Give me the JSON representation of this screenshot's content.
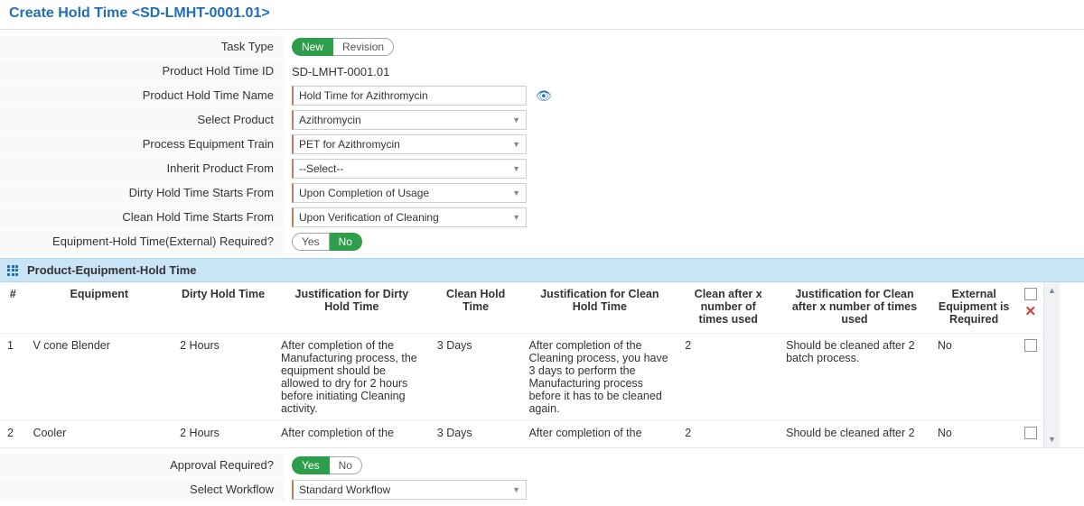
{
  "header": {
    "title": "Create Hold Time <SD-LMHT-0001.01>"
  },
  "form": {
    "task_type": {
      "label": "Task Type",
      "options": {
        "new": "New",
        "revision": "Revision"
      },
      "active": "new"
    },
    "hold_time_id": {
      "label": "Product Hold Time ID",
      "value": "SD-LMHT-0001.01"
    },
    "hold_time_name": {
      "label": "Product Hold Time Name",
      "value": "Hold Time for Azithromycin"
    },
    "select_product": {
      "label": "Select Product",
      "value": "Azithromycin"
    },
    "pet": {
      "label": "Process Equipment Train",
      "value": "PET for Azithromycin"
    },
    "inherit_from": {
      "label": "Inherit Product From",
      "value": "--Select--"
    },
    "dht_starts": {
      "label": "Dirty Hold Time Starts From",
      "value": "Upon Completion of Usage"
    },
    "cht_starts": {
      "label": "Clean Hold Time Starts From",
      "value": "Upon Verification of Cleaning"
    },
    "ext_required": {
      "label": "Equipment-Hold Time(External) Required?",
      "options": {
        "yes": "Yes",
        "no": "No"
      },
      "active": "no"
    },
    "approval_required": {
      "label": "Approval Required?",
      "options": {
        "yes": "Yes",
        "no": "No"
      },
      "active": "yes"
    },
    "select_workflow": {
      "label": "Select Workflow",
      "value": "Standard Workflow"
    }
  },
  "section": {
    "title": "Product-Equipment-Hold Time"
  },
  "table": {
    "headers": {
      "num": "#",
      "equipment": "Equipment",
      "dht": "Dirty Hold Time",
      "jdht": "Justification for Dirty Hold Time",
      "cht": "Clean Hold Time",
      "jcht": "Justification for Clean Hold Time",
      "cax": "Clean after x number of times used",
      "jcax": "Justification for Clean after x number of times used",
      "ext": "External Equipment is Required"
    },
    "rows": [
      {
        "num": "1",
        "equipment": "V cone Blender",
        "dht": "2 Hours",
        "jdht": "After completion of the Manufacturing process, the equipment should be allowed to dry for 2 hours before initiating Cleaning activity.",
        "cht": "3 Days",
        "jcht": "After completion of the Cleaning process, you have 3 days to perform the Manufacturing process before it has to be cleaned again.",
        "cax": "2",
        "jcax": "Should be cleaned after 2 batch process.",
        "ext": "No"
      },
      {
        "num": "2",
        "equipment": "Cooler",
        "dht": "2 Hours",
        "jdht": "After completion of the",
        "cht": "3 Days",
        "jcht": "After completion of the",
        "cax": "2",
        "jcax": "Should be cleaned after 2",
        "ext": "No"
      }
    ]
  }
}
